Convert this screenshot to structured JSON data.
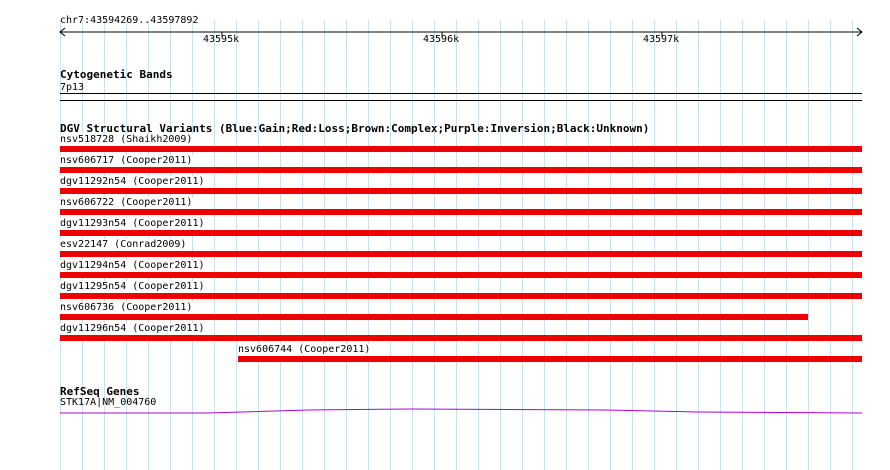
{
  "ruler": {
    "location": "chr7:43594269..43597892",
    "ticks": [
      "43595k",
      "43596k",
      "43597k"
    ]
  },
  "cytoband": {
    "title": "Cytogenetic Bands",
    "band": "7p13"
  },
  "dgv": {
    "title": "DGV Structural Variants (Blue:Gain;Red:Loss;Brown:Complex;Purple:Inversion;Black:Unknown)",
    "variants": [
      {
        "label": "nsv518728 (Shaikh2009)",
        "type": "Loss"
      },
      {
        "label": "nsv606717 (Cooper2011)",
        "type": "Loss"
      },
      {
        "label": "dgv11292n54 (Cooper2011)",
        "type": "Loss"
      },
      {
        "label": "nsv606722 (Cooper2011)",
        "type": "Loss"
      },
      {
        "label": "dgv11293n54 (Cooper2011)",
        "type": "Loss"
      },
      {
        "label": "esv22147 (Conrad2009)",
        "type": "Loss"
      },
      {
        "label": "dgv11294n54 (Cooper2011)",
        "type": "Loss"
      },
      {
        "label": "dgv11295n54 (Cooper2011)",
        "type": "Loss"
      },
      {
        "label": "nsv606736 (Cooper2011)",
        "type": "Loss"
      },
      {
        "label": "dgv11296n54 (Cooper2011)",
        "type": "Loss"
      },
      {
        "label": "nsv606744 (Cooper2011)",
        "type": "Loss"
      }
    ]
  },
  "refseq": {
    "title": "RefSeq Genes",
    "gene": "STK17A|NM_004760"
  },
  "colors": {
    "loss": "#ee0000",
    "gene": "#b000d8",
    "grid": "#c8e0f0",
    "grid_major": "#a8c8e8"
  }
}
